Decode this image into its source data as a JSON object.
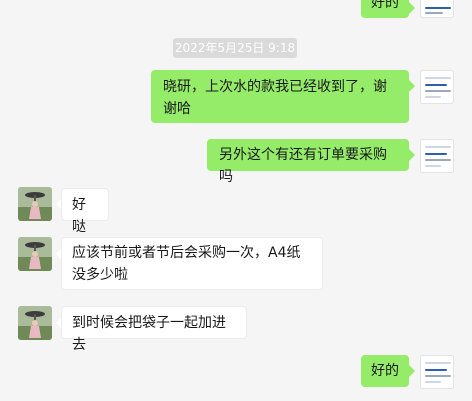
{
  "timestamp": "2022年5月25日 9:18",
  "messages": [
    {
      "sender": "self",
      "text": "好的"
    },
    {
      "sender": "self",
      "text": "晓研，上次水的款我已经收到了，谢谢哈"
    },
    {
      "sender": "self",
      "text": "另外这个有还有订单要采购吗"
    },
    {
      "sender": "other",
      "text": "好哒"
    },
    {
      "sender": "other",
      "text": "应该节前或者节后会采购一次，A4纸没多少啦"
    },
    {
      "sender": "other",
      "text": "到时候会把袋子一起加进去"
    },
    {
      "sender": "self",
      "text": "好的"
    }
  ],
  "colors": {
    "self_bubble": "#95ec69",
    "other_bubble": "#ffffff",
    "background": "#f5f5f5"
  }
}
